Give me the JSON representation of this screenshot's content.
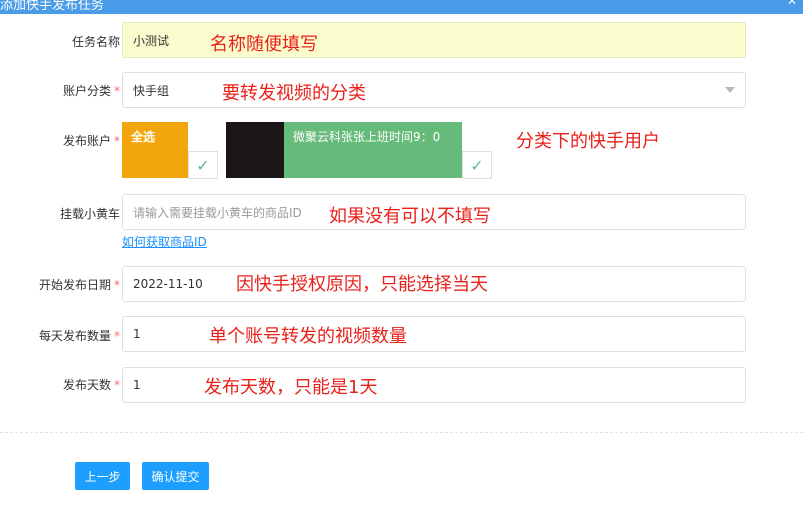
{
  "header": {
    "title": "添加快手发布任务",
    "close_icon": "close-icon"
  },
  "form": {
    "task_name": {
      "label": "任务名称",
      "value": "小测试",
      "note": "名称随便填写"
    },
    "account_category": {
      "label": "账户分类",
      "value": "快手组",
      "note": "要转发视频的分类"
    },
    "publish_accounts": {
      "label": "发布账户",
      "select_all": "全选",
      "account_name": "微聚云科张张上班时间9：0",
      "note": "分类下的快手用户"
    },
    "mount_cart": {
      "label": "挂载小黄车",
      "placeholder": "请输入需要挂载小黄车的商品ID",
      "note": "如果没有可以不填写",
      "link": "如何获取商品ID"
    },
    "start_date": {
      "label": "开始发布日期",
      "value": "2022-11-10",
      "note": "因快手授权原因，只能选择当天"
    },
    "daily_count": {
      "label": "每天发布数量",
      "value": "1",
      "note": "单个账号转发的视频数量"
    },
    "publish_days": {
      "label": "发布天数",
      "value": "1",
      "note": "发布天数，只能是1天"
    },
    "required_mark": "*"
  },
  "buttons": {
    "prev": "上一步",
    "submit": "确认提交"
  },
  "colors": {
    "accent": "#1e9fff",
    "annotation": "#e8211a",
    "required": "#f56c6c",
    "select_all_tile": "#f2a60c",
    "account_tile": "#66bb7a"
  }
}
